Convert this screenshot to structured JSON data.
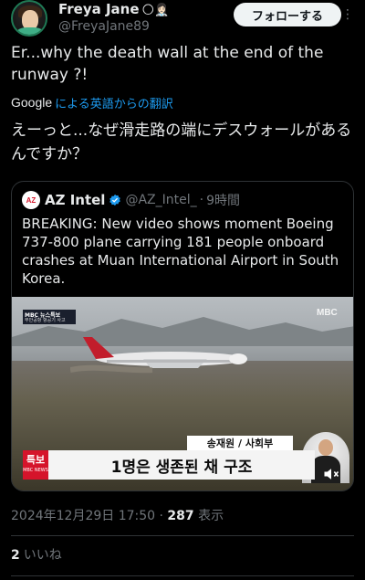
{
  "author": {
    "name": "Freya Jane",
    "emoji": "🌕👩🏻‍⚕️",
    "handle": "@FreyaJane89",
    "follow_label": "フォローする"
  },
  "tweet": {
    "text": "Er...why the death wall at the end of the runway ?!",
    "translate_logo": "Google",
    "translate_label": "による英語からの翻訳",
    "translated_text": "えーっと...なぜ滑走路の端にデスウォールがあるんですか？"
  },
  "quote": {
    "logo_text": "AZ",
    "name": "AZ Intel",
    "handle": "@AZ_Intel_",
    "separator": "·",
    "time": "9時間",
    "text": "BREAKING: New video shows moment Boeing 737-800 plane carrying 181 people onboard crashes at Muan International Airport in South Korea.",
    "media": {
      "corner_badge_line1": "MBC 뉴스특보",
      "corner_badge_line2": "무안공항 항공기 사고",
      "channel_logo": "MBC",
      "reporter_caption": "송재원 / 사회부",
      "breaking_tag": "특보",
      "breaking_sub": "MBC NEWS",
      "headline_caption": "1명은 생존된 채 구조"
    }
  },
  "meta": {
    "datetime": "2024年12月29日 17:50",
    "separator": "·",
    "views_count": "287",
    "views_label": "表示"
  },
  "stats": {
    "likes_count": "2",
    "likes_label": "いいね"
  },
  "colors": {
    "background": "#000000",
    "accent_link": "#1d9bf0",
    "verified": "#1d9bf0",
    "caption_red": "#d5142b"
  }
}
